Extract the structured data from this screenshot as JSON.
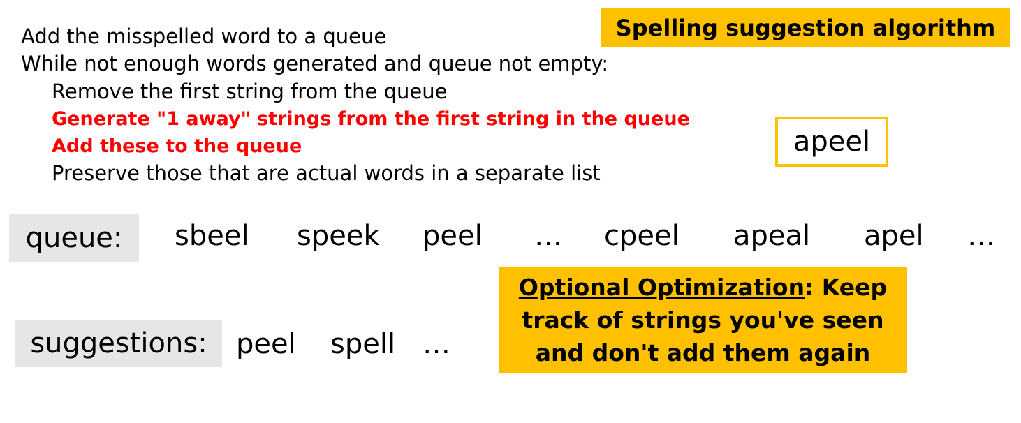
{
  "title": "Spelling suggestion algorithm",
  "algorithm": {
    "lines": [
      {
        "text": "Add the misspelled word to a queue",
        "indent": 0,
        "highlight": false
      },
      {
        "text": "While not enough words generated and queue not empty:",
        "indent": 0,
        "highlight": false
      },
      {
        "text": "Remove the first string from the queue",
        "indent": 1,
        "highlight": false
      },
      {
        "text": "Generate \"1 away\" strings from the first string in the queue",
        "indent": 1,
        "highlight": true
      },
      {
        "text": "Add these to the queue",
        "indent": 1,
        "highlight": true
      },
      {
        "text": "Preserve those that are actual words in a separate list",
        "indent": 1,
        "highlight": false
      }
    ]
  },
  "misspelled_word": "apeel",
  "queue": {
    "label": "queue:",
    "items": [
      "sbeel",
      "speek",
      "peel",
      "…",
      "cpeel",
      "apeal",
      "apel",
      "…"
    ]
  },
  "suggestions": {
    "label": "suggestions:",
    "items": [
      "peel",
      "spell",
      "…"
    ]
  },
  "optimization": {
    "heading": "Optional Optimization",
    "line1_rest": ": Keep",
    "line2": "track of strings you've seen",
    "line3": "and don't add them again"
  },
  "colors": {
    "accent": "#FFC000",
    "highlight_text": "#FF0000",
    "label_background": "#E7E6E6"
  }
}
